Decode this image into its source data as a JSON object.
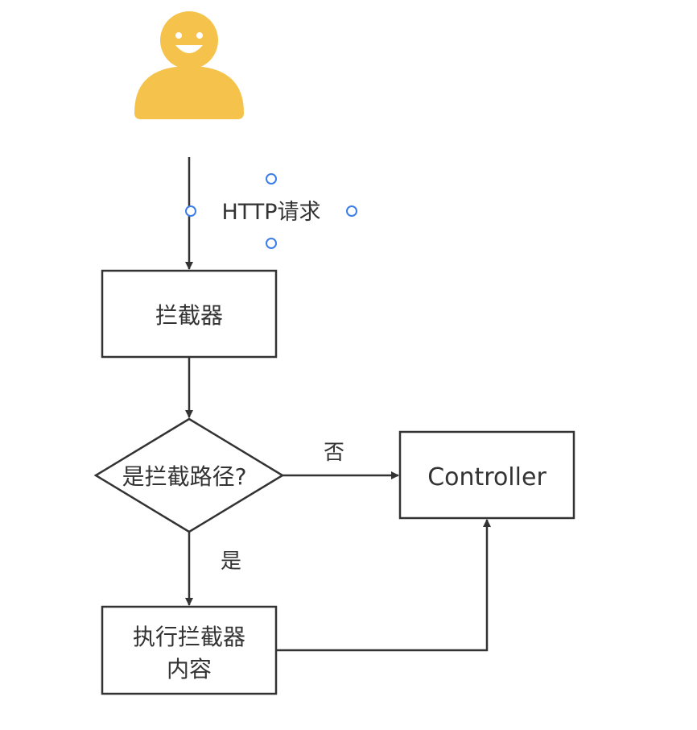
{
  "nodes": {
    "actor": {
      "icon": "person-icon",
      "color": "#F5C34B"
    },
    "request_label": "HTTP请求",
    "interceptor": "拦截器",
    "decision": "是拦截路径?",
    "controller": "Controller",
    "execute_line1": "执行拦截器",
    "execute_line2": "内容"
  },
  "edges": {
    "no_label": "否",
    "yes_label": "是"
  },
  "colors": {
    "stroke": "#333333",
    "selection": "#3B7DE9"
  }
}
